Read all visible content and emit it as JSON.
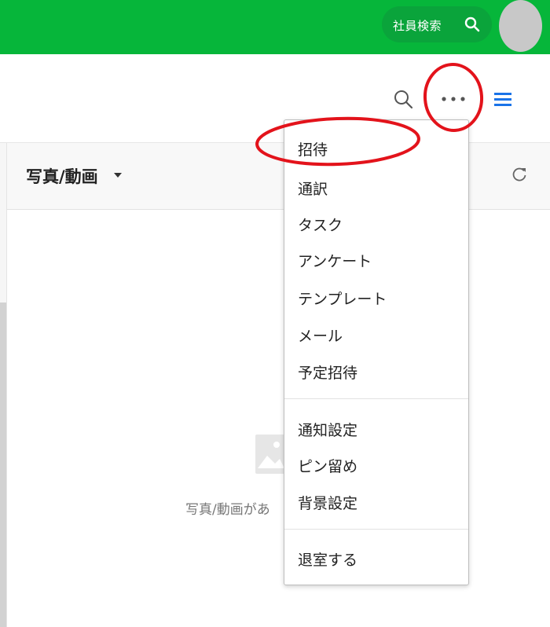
{
  "topbar": {
    "employee_search_label": "社員検索",
    "icons": [
      "search-icon"
    ],
    "brand_color": "#06b63a"
  },
  "header": {
    "icons": [
      "search-icon",
      "more-icon",
      "menu-icon"
    ],
    "accent_color": "#1a73e8"
  },
  "panel": {
    "title": "写真/動画",
    "empty_message": "写真/動画があ"
  },
  "menu": {
    "items": [
      {
        "label": "招待"
      },
      {
        "label": "通訳"
      },
      {
        "label": "タスク"
      },
      {
        "label": "アンケート"
      },
      {
        "label": "テンプレート"
      },
      {
        "label": "メール"
      },
      {
        "label": "予定招待"
      },
      {
        "label": "通知設定"
      },
      {
        "label": "ピン留め"
      },
      {
        "label": "背景設定"
      },
      {
        "label": "退室する"
      }
    ]
  },
  "annotation_color": "#e3131b"
}
